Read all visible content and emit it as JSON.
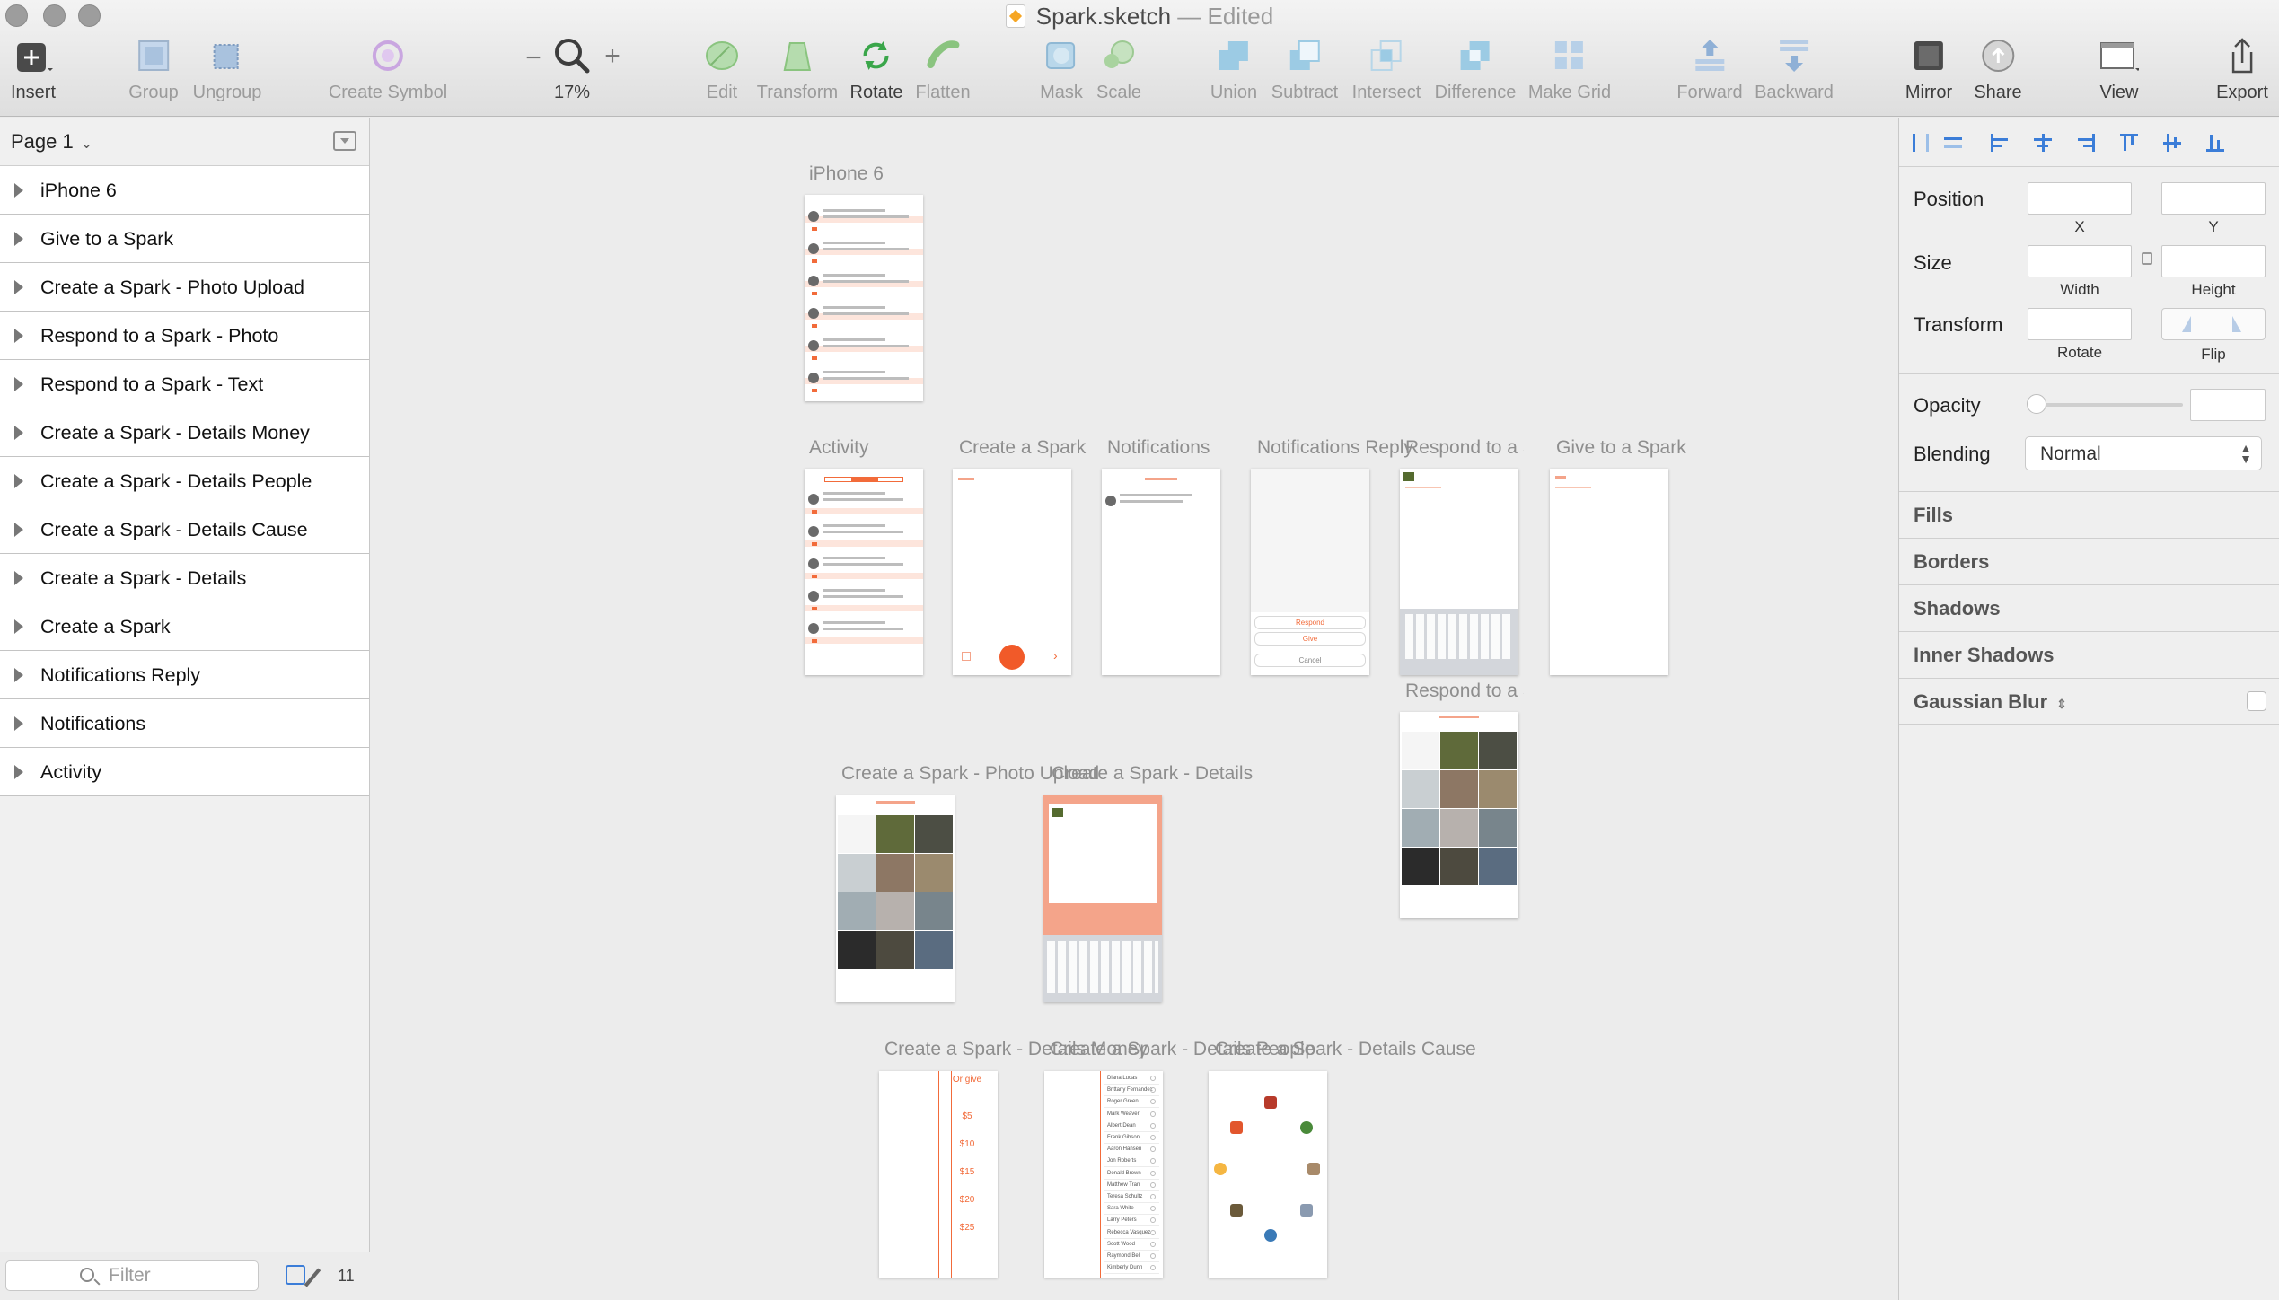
{
  "window": {
    "title": "Spark.sketch",
    "status": "— Edited"
  },
  "toolbar": {
    "insert": "Insert",
    "group": "Group",
    "ungroup": "Ungroup",
    "create_symbol": "Create Symbol",
    "zoom_level": "17%",
    "zoom_out": "−",
    "zoom_in": "+",
    "edit": "Edit",
    "transform": "Transform",
    "rotate": "Rotate",
    "flatten": "Flatten",
    "mask": "Mask",
    "scale": "Scale",
    "union": "Union",
    "subtract": "Subtract",
    "intersect": "Intersect",
    "difference": "Difference",
    "make_grid": "Make Grid",
    "forward": "Forward",
    "backward": "Backward",
    "mirror": "Mirror",
    "share": "Share",
    "view": "View",
    "export": "Export"
  },
  "sidebar": {
    "page": "Page 1",
    "layers": [
      "iPhone 6",
      "Give to a Spark",
      "Create a Spark - Photo Upload",
      "Respond to a Spark - Photo",
      "Respond to a Spark - Text",
      "Create a Spark - Details Money",
      "Create a Spark - Details People",
      "Create a Spark - Details Cause",
      "Create a Spark - Details",
      "Create a Spark",
      "Notifications Reply",
      "Notifications",
      "Activity"
    ],
    "filter_placeholder": "Filter",
    "count": "11"
  },
  "canvas": {
    "artboards": {
      "iphone6": "iPhone 6",
      "activity": "Activity",
      "create": "Create a Spark",
      "notifications": "Notifications",
      "notif_reply": "Notifications Reply",
      "respond_text": "Respond to a Spa",
      "give": "Give to a Spark",
      "respond_photo": "Respond to a Spa",
      "photo_upload": "Create a Spark - Photo Upload",
      "details": "Create a Spark - Details",
      "details_money": "Create a Spark - Details Money",
      "details_people": "Create a Spark - Details People",
      "details_cause": "Create a Spark - Details Cause"
    },
    "money_header": "Or give",
    "money_amounts": [
      "$5",
      "$10",
      "$15",
      "$20",
      "$25"
    ],
    "people_names": [
      "Diana Lucas",
      "Brittany Fernandez",
      "Roger Green",
      "Mark Weaver",
      "Albert Dean",
      "Frank Gibson",
      "Aaron Hansen",
      "Jon Roberts",
      "Donald Brown",
      "Matthew Tran",
      "Teresa Schultz",
      "Sara White",
      "Larry Peters",
      "Rebecca Vasquez",
      "Scott Wood",
      "Raymond Bell",
      "Kimberly Dunn"
    ],
    "reply_buttons": [
      "Respond",
      "Give",
      "Cancel"
    ]
  },
  "inspector": {
    "position": "Position",
    "x": "X",
    "y": "Y",
    "size": "Size",
    "width": "Width",
    "height": "Height",
    "transform": "Transform",
    "rotate": "Rotate",
    "flip": "Flip",
    "opacity": "Opacity",
    "blending": "Blending",
    "blend_mode": "Normal",
    "fills": "Fills",
    "borders": "Borders",
    "shadows": "Shadows",
    "inner_shadows": "Inner Shadows",
    "gaussian_blur": "Gaussian Blur"
  },
  "colors": {
    "accent": "#3b7dd8",
    "brand_orange": "#f15a29",
    "pale_orange": "#f4a48a"
  }
}
